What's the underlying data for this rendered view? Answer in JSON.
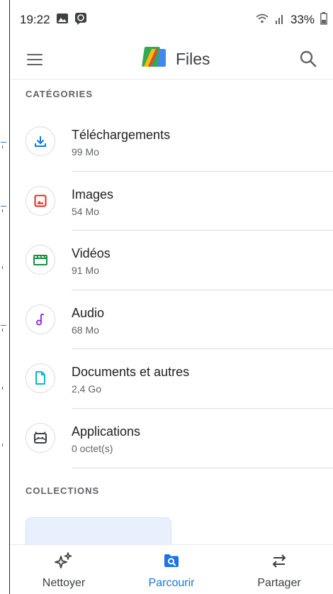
{
  "status_bar": {
    "time": "19:22",
    "battery_percent": "33%",
    "icons": [
      "gallery-icon",
      "message-icon",
      "wifi-icon",
      "signal-icon",
      "battery-icon"
    ]
  },
  "app_bar": {
    "title": "Files",
    "menu_icon": "menu-icon",
    "search_icon": "search-icon",
    "logo_icon": "files-logo-icon"
  },
  "categories": {
    "header": "CATÉGORIES",
    "items": [
      {
        "name": "Téléchargements",
        "size": "99 Mo",
        "icon": "download-icon",
        "color": "#1a73e8"
      },
      {
        "name": "Images",
        "size": "54 Mo",
        "icon": "image-icon",
        "color": "#d93025"
      },
      {
        "name": "Vidéos",
        "size": "91 Mo",
        "icon": "video-icon",
        "color": "#1e8e3e"
      },
      {
        "name": "Audio",
        "size": "68 Mo",
        "icon": "audio-icon",
        "color": "#9334e6"
      },
      {
        "name": "Documents et autres",
        "size": "2,4 Go",
        "icon": "document-icon",
        "color": "#12b5cb"
      },
      {
        "name": "Applications",
        "size": "0 octet(s)",
        "icon": "android-icon",
        "color": "#3c4043"
      }
    ]
  },
  "collections": {
    "header": "COLLECTIONS"
  },
  "bottom_nav": {
    "items": [
      {
        "label": "Nettoyer",
        "icon": "sparkle-icon",
        "active": false
      },
      {
        "label": "Parcourir",
        "icon": "browse-icon",
        "active": true
      },
      {
        "label": "Partager",
        "icon": "swap-icon",
        "active": false
      }
    ],
    "active_color": "#1a73e8"
  }
}
